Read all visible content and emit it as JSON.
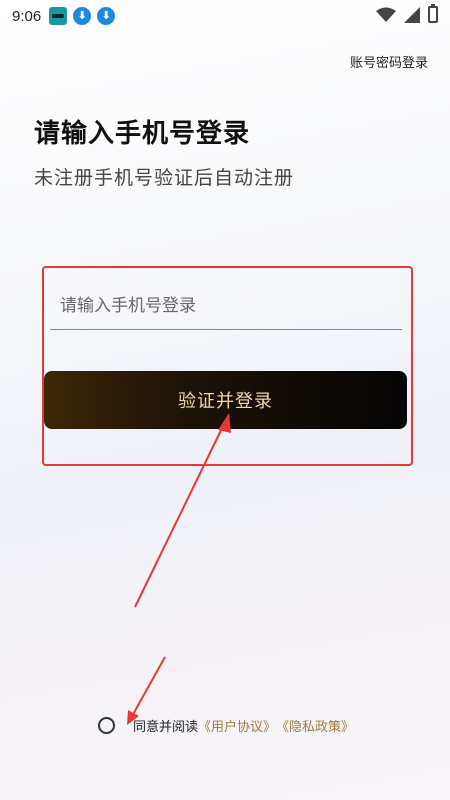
{
  "status_bar": {
    "time": "9:06",
    "download_glyph": "⬇"
  },
  "header": {
    "account_login": "账号密码登录"
  },
  "main": {
    "title": "请输入手机号登录",
    "subtitle": "未注册手机号验证后自动注册",
    "phone_placeholder": "请输入手机号登录",
    "submit_label": "验证并登录"
  },
  "agreement": {
    "prefix": "同意并阅读",
    "user_agreement": "《用户协议》",
    "privacy_policy": "《隐私政策》"
  },
  "colors": {
    "annotation_red": "#e53935",
    "link_gold": "#a07a3c",
    "button_text": "#f4d9a8"
  },
  "icons": [
    "app-notification-icon",
    "download-icon",
    "download-icon",
    "wifi-icon",
    "signal-icon",
    "battery-icon",
    "radio-unchecked-icon"
  ]
}
